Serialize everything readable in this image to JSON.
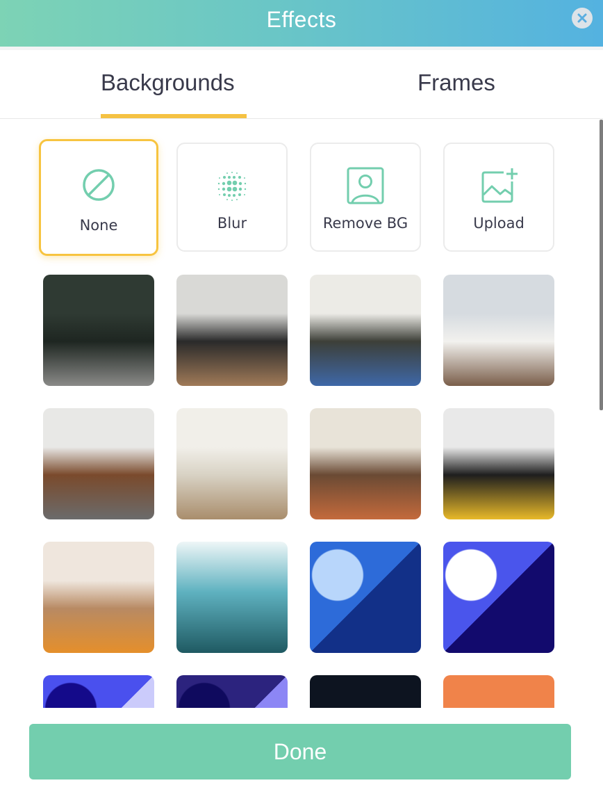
{
  "header": {
    "title": "Effects",
    "close_icon": "close-circle-icon"
  },
  "tabs": [
    {
      "label": "Backgrounds",
      "active": true
    },
    {
      "label": "Frames",
      "active": false
    }
  ],
  "options": [
    {
      "label": "None",
      "icon": "no-symbol-icon",
      "selected": true
    },
    {
      "label": "Blur",
      "icon": "blur-dots-icon",
      "selected": false
    },
    {
      "label": "Remove BG",
      "icon": "person-portrait-icon",
      "selected": false
    },
    {
      "label": "Upload",
      "icon": "image-add-icon",
      "selected": false
    }
  ],
  "thumbnails": [
    {
      "name": "dark-green-living-room",
      "colors": [
        "#2f3a33",
        "#1e2621",
        "#8a8a88"
      ]
    },
    {
      "name": "loft-dining-staircase",
      "colors": [
        "#d9d9d6",
        "#2a2a2a",
        "#a07a58"
      ]
    },
    {
      "name": "bright-kitchen-living",
      "colors": [
        "#ecebe6",
        "#3d3f38",
        "#3e68a8"
      ]
    },
    {
      "name": "home-office-desk",
      "colors": [
        "#d6dbe0",
        "#f2f1ee",
        "#7a5e4a"
      ]
    },
    {
      "name": "modern-living-wood-wall",
      "colors": [
        "#e8e8e6",
        "#7a4a2c",
        "#6b6b6b"
      ]
    },
    {
      "name": "white-living-room",
      "colors": [
        "#f1efe9",
        "#d8d2c4",
        "#a98d6c"
      ]
    },
    {
      "name": "arched-window-living",
      "colors": [
        "#e8e3d8",
        "#6a4a34",
        "#c46a3c"
      ]
    },
    {
      "name": "yellow-armchair-room",
      "colors": [
        "#e9e9e9",
        "#1e1e1e",
        "#e8b929"
      ]
    },
    {
      "name": "sunny-dining-room",
      "colors": [
        "#efe6dd",
        "#b88a63",
        "#e58f2b"
      ]
    },
    {
      "name": "misty-mountains",
      "colors": [
        "#eef6f7",
        "#5fb2c0",
        "#1f5a62"
      ]
    },
    {
      "name": "blue-geometric-pattern",
      "colors": [
        "#2d6bd9",
        "#123088",
        "#b8d6fb"
      ]
    },
    {
      "name": "indigo-geometric-pattern",
      "colors": [
        "#4a55ec",
        "#120a6d",
        "#ffffff"
      ]
    },
    {
      "name": "violet-triangles-pattern",
      "colors": [
        "#4a50ee",
        "#cbcbfb",
        "#140a8a"
      ]
    },
    {
      "name": "navy-shapes-pattern",
      "colors": [
        "#2c237e",
        "#8c86f5",
        "#0f0a5e"
      ]
    },
    {
      "name": "dark-window-gradient",
      "colors": [
        "#0d1420",
        "#7d96b6",
        "#2a3a52"
      ]
    },
    {
      "name": "orange-abstract-waves",
      "colors": [
        "#f0834a",
        "#e05a2a",
        "#b9c5d9"
      ]
    }
  ],
  "footer": {
    "done_label": "Done"
  },
  "colors": {
    "accent_green": "#73ceae",
    "tab_underline": "#f5c243",
    "text_dark": "#393a4b"
  }
}
